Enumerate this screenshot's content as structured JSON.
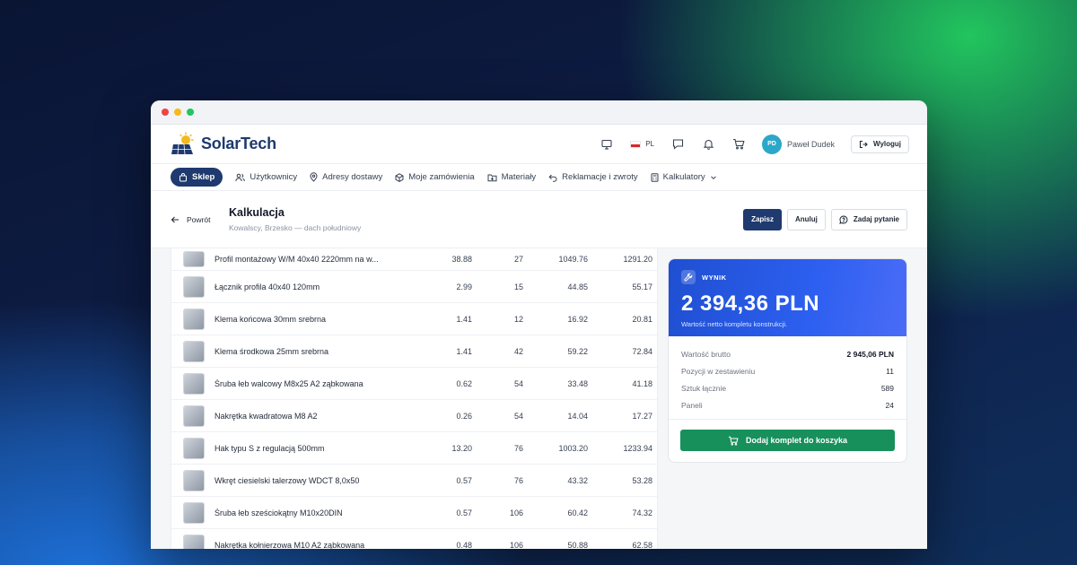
{
  "brand": {
    "name": "SolarTech"
  },
  "topbar": {
    "lang": "PL",
    "user_initials": "PD",
    "user_name": "Paweł Dudek",
    "logout_label": "Wyloguj"
  },
  "nav": {
    "items": [
      {
        "label": "Sklep"
      },
      {
        "label": "Użytkownicy"
      },
      {
        "label": "Adresy dostawy"
      },
      {
        "label": "Moje zamówienia"
      },
      {
        "label": "Materiały"
      },
      {
        "label": "Reklamacje i zwroty"
      },
      {
        "label": "Kalkulatory"
      }
    ]
  },
  "page": {
    "back_label": "Powrót",
    "title": "Kalkulacja",
    "subtitle": "Kowalscy, Brzesko — dach południowy",
    "save_label": "Zapisz",
    "cancel_label": "Anuluj",
    "ask_label": "Zadaj pytanie"
  },
  "items": [
    {
      "name": "Profil montażowy W/M 40x40 2220mm na w...",
      "price": "38.88",
      "qty": "27",
      "net": "1049.76",
      "gross": "1291.20"
    },
    {
      "name": "Łącznik profila 40x40 120mm",
      "price": "2.99",
      "qty": "15",
      "net": "44.85",
      "gross": "55.17"
    },
    {
      "name": "Klema końcowa 30mm srebrna",
      "price": "1.41",
      "qty": "12",
      "net": "16.92",
      "gross": "20.81"
    },
    {
      "name": "Klema środkowa 25mm srebrna",
      "price": "1.41",
      "qty": "42",
      "net": "59.22",
      "gross": "72.84"
    },
    {
      "name": "Śruba łeb walcowy M8x25 A2 ząbkowana",
      "price": "0.62",
      "qty": "54",
      "net": "33.48",
      "gross": "41.18"
    },
    {
      "name": "Nakrętka kwadratowa M8 A2",
      "price": "0.26",
      "qty": "54",
      "net": "14.04",
      "gross": "17.27"
    },
    {
      "name": "Hak typu S z regulacją 500mm",
      "price": "13.20",
      "qty": "76",
      "net": "1003.20",
      "gross": "1233.94"
    },
    {
      "name": "Wkręt ciesielski talerzowy WDCT 8,0x50",
      "price": "0.57",
      "qty": "76",
      "net": "43.32",
      "gross": "53.28"
    },
    {
      "name": "Śruba łeb sześciokątny M10x20DIN",
      "price": "0.57",
      "qty": "106",
      "net": "60.42",
      "gross": "74.32"
    },
    {
      "name": "Nakrętka kołnierzowa M10 A2 ząbkowana",
      "price": "0.48",
      "qty": "106",
      "net": "50.88",
      "gross": "62.58"
    }
  ],
  "result": {
    "label": "WYNIK",
    "value": "2 394,36 PLN",
    "note": "Wartość netto kompletu konstrukcji.",
    "stats": [
      {
        "label": "Wartość brutto",
        "value": "2 945,06 PLN"
      },
      {
        "label": "Pozycji w zestawieniu",
        "value": "11"
      },
      {
        "label": "Sztuk łącznie",
        "value": "589"
      },
      {
        "label": "Paneli",
        "value": "24"
      }
    ],
    "cart_label": "Dodaj komplet do koszyka"
  }
}
